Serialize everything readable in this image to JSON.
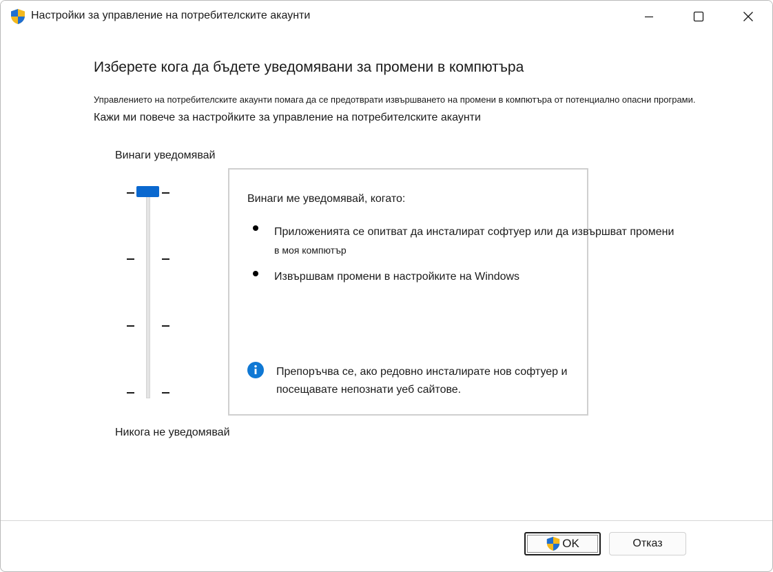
{
  "window": {
    "title": "Настройки за управление на потребителските акаунти",
    "icons": {
      "app": "uac-shield-icon",
      "minimize": "minimize-icon",
      "maximize": "maximize-icon",
      "close": "close-icon"
    }
  },
  "main": {
    "heading": "Изберете кога да бъдете уведомявани за промени в компютъра",
    "description": "Управлението на потребителските акаунти помага да се предотврати извършването на промени в компютъра от потенциално опасни програми.",
    "learn_more_link": "Кажи ми повече за настройките за управление на потребителските акаунти"
  },
  "slider": {
    "top_label": "Винаги уведомявай",
    "bottom_label": "Никога не уведомявай",
    "levels": 4,
    "selected_level": 4,
    "thumb_color": "#0a68cf"
  },
  "info": {
    "heading": "Винаги ме уведомявай, когато:",
    "bullets": [
      {
        "line1": "Приложенията се опитват да инсталират софтуер или да извършват промени",
        "line2": "в моя компютър"
      },
      {
        "line1": "Извършвам промени в настройките на Windows"
      }
    ],
    "recommendation_icon": "info-icon",
    "recommendation_line1": "Препоръчва се, ако редовно инсталирате нов софтуер и",
    "recommendation_line2": "посещавате непознати уеб сайтове."
  },
  "buttons": {
    "ok_label": "OK",
    "ok_icon": "uac-shield-icon",
    "cancel_label": "Отказ"
  },
  "colors": {
    "accent": "#0a68cf",
    "info_icon": "#0f78d4"
  }
}
